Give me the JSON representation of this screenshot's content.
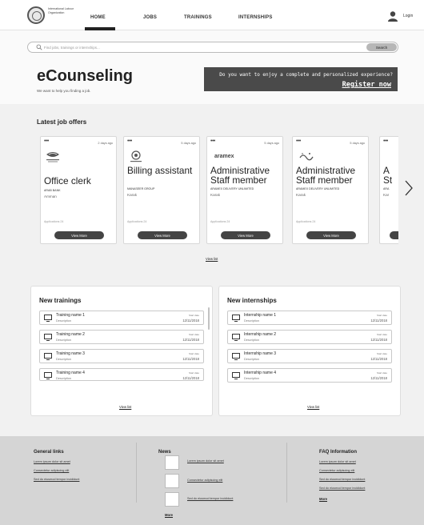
{
  "header": {
    "logo_text": "International Labour Organization",
    "nav": [
      "HOME",
      "JOBS",
      "TRAININGS",
      "INTERNSHIPS"
    ],
    "active_nav": "HOME",
    "login": "Login",
    "login_icon": "user-icon"
  },
  "hero": {
    "search_placeholder": "Find jobs, trainings or internships...",
    "search_button": "Search",
    "title": "eCounseling",
    "subtitle": "We want to help you finding a job.",
    "promo_text": "Do you want to enjoy a complete and personalized experience?",
    "promo_link": "Register now",
    "promo_color": "#4a4a4a"
  },
  "jobs": {
    "title": "Latest job offers",
    "more_options": "•••",
    "view_list": "View list",
    "cards": [
      {
        "date": "2 days ago",
        "title": "Office clerk",
        "company": "ARAB BANK",
        "location": "Amman",
        "applications": "Applications 24",
        "button": "View More"
      },
      {
        "date": "5 days ago",
        "title": "Billing assistant",
        "company": "MANASEER GROUP",
        "location": "Karak",
        "applications": "Applications 24",
        "button": "View More"
      },
      {
        "date": "5 days ago",
        "title": "Administrative Staff member",
        "company": "ARAMEX DELIVERY UNLIMITED",
        "location": "Karak",
        "applications": "Applications 24",
        "button": "View More",
        "logo_text": "aramex"
      },
      {
        "date": "5 days ago",
        "title": "Administrative Staff member",
        "company": "ARAMEX DELIVERY UNLIMITED",
        "location": "Karak",
        "applications": "Applications 24",
        "button": "View More"
      }
    ],
    "partial_card": {
      "title": "A St",
      "company": "ARA",
      "location": "Kar"
    },
    "next_icon": "chevron-right-icon"
  },
  "trainings": {
    "title": "New trainings",
    "view_list": "View list",
    "items": [
      {
        "name": "Training name 1",
        "description": "Description",
        "start_label": "Start date",
        "date": "12/11/2018"
      },
      {
        "name": "Training name 2",
        "description": "Description",
        "start_label": "Start date",
        "date": "12/11/2018"
      },
      {
        "name": "Training name 3",
        "description": "Description",
        "start_label": "Start date",
        "date": "12/11/2018"
      },
      {
        "name": "Training name 4",
        "description": "Description",
        "start_label": "Start date",
        "date": "12/11/2018"
      }
    ]
  },
  "internships": {
    "title": "New internships",
    "view_list": "View list",
    "items": [
      {
        "name": "Internship name 1",
        "description": "Description",
        "start_label": "Start date",
        "date": "12/11/2018"
      },
      {
        "name": "Internship name 2",
        "description": "Description",
        "start_label": "Start date",
        "date": "12/11/2018"
      },
      {
        "name": "Internship name 3",
        "description": "Description",
        "start_label": "Start date",
        "date": "12/11/2018"
      },
      {
        "name": "Internship name 4",
        "description": "Description",
        "start_label": "Start date",
        "date": "12/11/2018"
      }
    ]
  },
  "footer": {
    "general": {
      "title": "General links",
      "links": [
        "Lorem ipsum dolor sit amet",
        "Consectetur adipiscing elit",
        "Sed do eiusmod tempor incididunt"
      ]
    },
    "news": {
      "title": "News",
      "links": [
        "Lorem ipsum dolor sit amet",
        "Consectetur adipiscing elit",
        "Sed do eiusmod tempor incididunt"
      ],
      "more": "More"
    },
    "faq": {
      "title": "FAQ Information",
      "links": [
        "Lorem ipsum dolor sit amet",
        "Consectetur adipiscing elit",
        "Sed do eiusmod tempor incididunt",
        "Sed do eiusmod tempor incididunt"
      ],
      "more": "More"
    }
  }
}
